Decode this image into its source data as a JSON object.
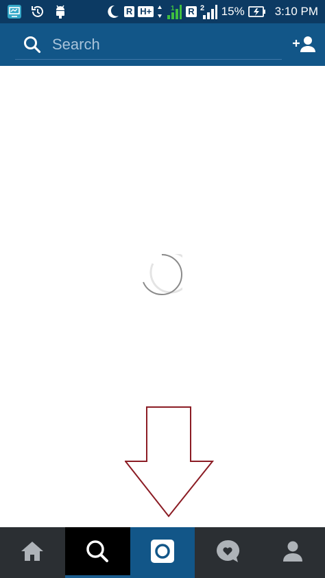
{
  "status_bar": {
    "left_icons": [
      "screen-cast-icon",
      "sync-icon",
      "android-debug-icon"
    ],
    "right_icons": [
      "do-not-disturb-moon-icon",
      "roaming-r-icon",
      "hspa-plus-icon",
      "signal-sim1-icon",
      "roaming-r-icon",
      "signal-sim2-icon",
      "battery-charging-icon"
    ],
    "roaming_label": "R",
    "network_label": "H+",
    "sim1_label": "1",
    "sim2_label": "2",
    "battery": "15%",
    "time": "3:10 PM"
  },
  "header": {
    "search_placeholder": "Search",
    "search_value": "",
    "action_icon": "add-person-icon"
  },
  "content": {
    "state": "loading",
    "icons": [
      "loading-spinner-icon",
      "down-arrow-annotation-icon"
    ]
  },
  "bottom_nav": {
    "tabs": [
      {
        "name": "home",
        "icon": "home-icon"
      },
      {
        "name": "explore",
        "icon": "search-icon",
        "state": "active"
      },
      {
        "name": "camera",
        "icon": "camera-icon",
        "state": "highlighted"
      },
      {
        "name": "activity",
        "icon": "heart-bubble-icon"
      },
      {
        "name": "profile",
        "icon": "person-icon"
      }
    ]
  },
  "colors": {
    "status_bar": "#0c3a63",
    "header": "#125688",
    "nav_bar": "#2b2f33",
    "annotation_arrow": "#8b1c24"
  }
}
